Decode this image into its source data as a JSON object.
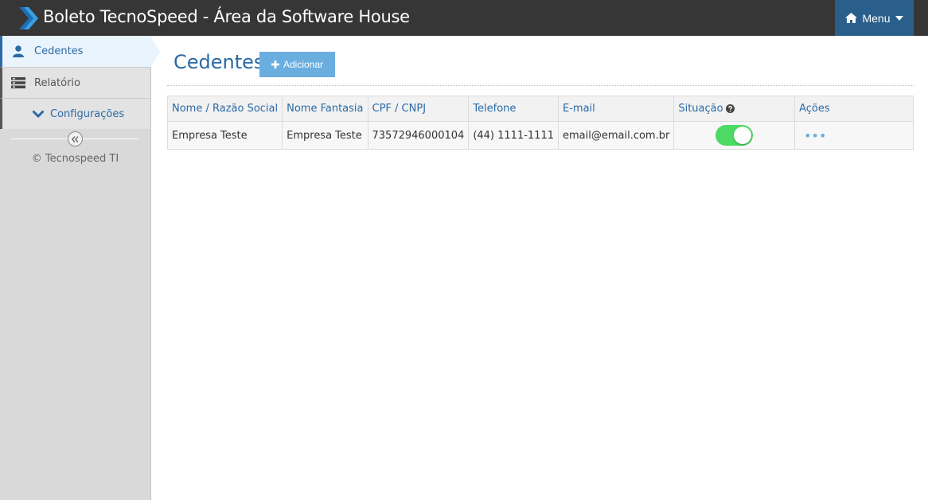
{
  "header": {
    "title": "Boleto TecnoSpeed - Área da Software House",
    "menu_label": "Menu"
  },
  "sidebar": {
    "items": [
      {
        "label": "Cedentes",
        "icon": "user-icon",
        "active": true
      },
      {
        "label": "Relatório",
        "icon": "list-icon",
        "active": false
      },
      {
        "label": "Configurações",
        "icon": "chevron-down-icon",
        "active": false
      }
    ],
    "collapse_label": "«",
    "copyright": "© Tecnospeed TI"
  },
  "main": {
    "title": "Cedentes",
    "add_button": "Adicionar",
    "table": {
      "columns": [
        "Nome / Razão Social",
        "Nome Fantasia",
        "CPF / CNPJ",
        "Telefone",
        "E-mail",
        "Situação",
        "Ações"
      ],
      "rows": [
        {
          "razao_social": "Empresa Teste",
          "nome_fantasia": "Empresa Teste",
          "cpf_cnpj": "73572946000104",
          "telefone": "(44) 1111-1111",
          "email": "email@email.com.br",
          "situacao_active": true,
          "acoes": "•••"
        }
      ]
    }
  },
  "colors": {
    "topbar": "#363636",
    "menu_button": "#2a5f8c",
    "accent": "#2a6aa6",
    "add_button": "#6aaee0",
    "toggle_on": "#4cd964"
  }
}
